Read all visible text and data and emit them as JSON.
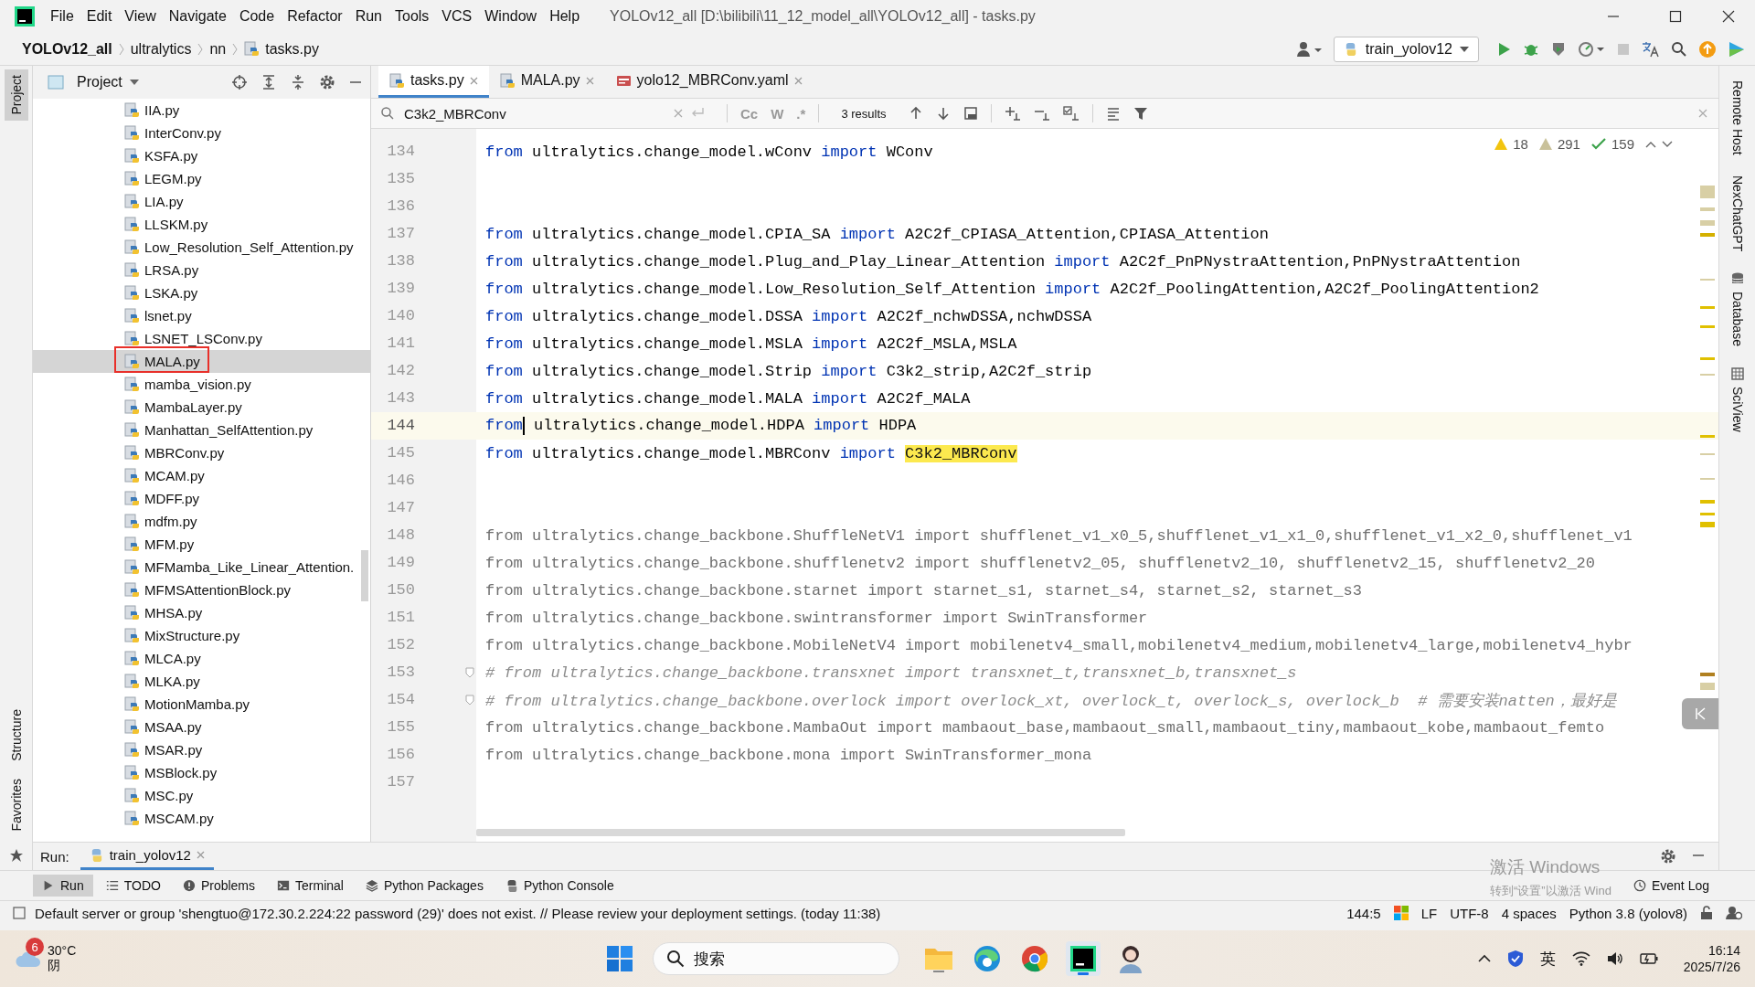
{
  "window": {
    "title": "YOLOv12_all [D:\\bilibili\\11_12_model_all\\YOLOv12_all] - tasks.py",
    "menu": [
      "File",
      "Edit",
      "View",
      "Navigate",
      "Code",
      "Refactor",
      "Run",
      "Tools",
      "VCS",
      "Window",
      "Help"
    ]
  },
  "navigation": {
    "breadcrumbs": [
      "YOLOv12_all",
      "ultralytics",
      "nn",
      "tasks.py"
    ],
    "run_config": "train_yolov12"
  },
  "left_tool_windows": [
    {
      "label": "Project",
      "selected": true
    },
    {
      "label": "Structure",
      "selected": false
    },
    {
      "label": "Favorites",
      "selected": false
    }
  ],
  "project_panel": {
    "title": "Project",
    "items": [
      {
        "name": "IIA.py",
        "selected": false,
        "outlined": false
      },
      {
        "name": "InterConv.py",
        "selected": false,
        "outlined": false
      },
      {
        "name": "KSFA.py",
        "selected": false,
        "outlined": false
      },
      {
        "name": "LEGM.py",
        "selected": false,
        "outlined": false
      },
      {
        "name": "LIA.py",
        "selected": false,
        "outlined": false
      },
      {
        "name": "LLSKM.py",
        "selected": false,
        "outlined": false
      },
      {
        "name": "Low_Resolution_Self_Attention.py",
        "selected": false,
        "outlined": false
      },
      {
        "name": "LRSA.py",
        "selected": false,
        "outlined": false
      },
      {
        "name": "LSKA.py",
        "selected": false,
        "outlined": false
      },
      {
        "name": "lsnet.py",
        "selected": false,
        "outlined": false
      },
      {
        "name": "LSNET_LSConv.py",
        "selected": false,
        "outlined": false
      },
      {
        "name": "MALA.py",
        "selected": true,
        "outlined": true
      },
      {
        "name": "mamba_vision.py",
        "selected": false,
        "outlined": false
      },
      {
        "name": "MambaLayer.py",
        "selected": false,
        "outlined": false
      },
      {
        "name": "Manhattan_SelfAttention.py",
        "selected": false,
        "outlined": false
      },
      {
        "name": "MBRConv.py",
        "selected": false,
        "outlined": false
      },
      {
        "name": "MCAM.py",
        "selected": false,
        "outlined": false
      },
      {
        "name": "MDFF.py",
        "selected": false,
        "outlined": false
      },
      {
        "name": "mdfm.py",
        "selected": false,
        "outlined": false
      },
      {
        "name": "MFM.py",
        "selected": false,
        "outlined": false
      },
      {
        "name": "MFMamba_Like_Linear_Attention.",
        "selected": false,
        "outlined": false
      },
      {
        "name": "MFMSAttentionBlock.py",
        "selected": false,
        "outlined": false
      },
      {
        "name": "MHSA.py",
        "selected": false,
        "outlined": false
      },
      {
        "name": "MixStructure.py",
        "selected": false,
        "outlined": false
      },
      {
        "name": "MLCA.py",
        "selected": false,
        "outlined": false
      },
      {
        "name": "MLKA.py",
        "selected": false,
        "outlined": false
      },
      {
        "name": "MotionMamba.py",
        "selected": false,
        "outlined": false
      },
      {
        "name": "MSAA.py",
        "selected": false,
        "outlined": false
      },
      {
        "name": "MSAR.py",
        "selected": false,
        "outlined": false
      },
      {
        "name": "MSBlock.py",
        "selected": false,
        "outlined": false
      },
      {
        "name": "MSC.py",
        "selected": false,
        "outlined": false
      },
      {
        "name": "MSCAM.py",
        "selected": false,
        "outlined": false
      }
    ]
  },
  "editor_tabs": [
    {
      "label": "tasks.py",
      "selected": true,
      "kind": "python"
    },
    {
      "label": "MALA.py",
      "selected": false,
      "kind": "python"
    },
    {
      "label": "yolo12_MBRConv.yaml",
      "selected": false,
      "kind": "yaml"
    }
  ],
  "find": {
    "value": "C3k2_MBRConv",
    "options": [
      "Cc",
      "W",
      ".*"
    ],
    "results": "3 results"
  },
  "inspections": {
    "warnings": "18",
    "weak_warnings": "291",
    "typos": "159"
  },
  "code_lines": [
    {
      "number": "134",
      "kind": "code",
      "current": false,
      "segments": [
        {
          "kind": "keyword",
          "text": "from"
        },
        {
          "kind": "name",
          "text": " ultralytics.change_model.wConv "
        },
        {
          "kind": "keyword",
          "text": "import"
        },
        {
          "kind": "name",
          "text": " WConv"
        }
      ]
    },
    {
      "number": "135",
      "kind": "blank",
      "current": false
    },
    {
      "number": "136",
      "kind": "blank",
      "current": false
    },
    {
      "number": "137",
      "kind": "code",
      "current": false,
      "segments": [
        {
          "kind": "keyword",
          "text": "from"
        },
        {
          "kind": "name",
          "text": " ultralytics.change_model.CPIA_SA "
        },
        {
          "kind": "keyword",
          "text": "import"
        },
        {
          "kind": "name",
          "text": " A2C2f_CPIASA_Attention,CPIASA_Attention"
        }
      ]
    },
    {
      "number": "138",
      "kind": "code",
      "current": false,
      "segments": [
        {
          "kind": "keyword",
          "text": "from"
        },
        {
          "kind": "name",
          "text": " ultralytics.change_model.Plug_and_Play_Linear_Attention "
        },
        {
          "kind": "keyword",
          "text": "import"
        },
        {
          "kind": "name",
          "text": " A2C2f_PnPNystraAttention,PnPNystraAttention"
        }
      ]
    },
    {
      "number": "139",
      "kind": "code",
      "current": false,
      "segments": [
        {
          "kind": "keyword",
          "text": "from"
        },
        {
          "kind": "name",
          "text": " ultralytics.change_model.Low_Resolution_Self_Attention "
        },
        {
          "kind": "keyword",
          "text": "import"
        },
        {
          "kind": "name",
          "text": " A2C2f_PoolingAttention,A2C2f_PoolingAttention2"
        }
      ]
    },
    {
      "number": "140",
      "kind": "code",
      "current": false,
      "segments": [
        {
          "kind": "keyword",
          "text": "from"
        },
        {
          "kind": "name",
          "text": " ultralytics.change_model.DSSA "
        },
        {
          "kind": "keyword",
          "text": "import"
        },
        {
          "kind": "name",
          "text": " A2C2f_nchwDSSA,nchwDSSA"
        }
      ]
    },
    {
      "number": "141",
      "kind": "code",
      "current": false,
      "segments": [
        {
          "kind": "keyword",
          "text": "from"
        },
        {
          "kind": "name",
          "text": " ultralytics.change_model.MSLA "
        },
        {
          "kind": "keyword",
          "text": "import"
        },
        {
          "kind": "name",
          "text": " A2C2f_MSLA,MSLA"
        }
      ]
    },
    {
      "number": "142",
      "kind": "code",
      "current": false,
      "segments": [
        {
          "kind": "keyword",
          "text": "from"
        },
        {
          "kind": "name",
          "text": " ultralytics.change_model.Strip "
        },
        {
          "kind": "keyword",
          "text": "import"
        },
        {
          "kind": "name",
          "text": " C3k2_strip,A2C2f_strip"
        }
      ]
    },
    {
      "number": "143",
      "kind": "code",
      "current": false,
      "segments": [
        {
          "kind": "keyword",
          "text": "from"
        },
        {
          "kind": "name",
          "text": " ultralytics.change_model.MALA "
        },
        {
          "kind": "keyword",
          "text": "import"
        },
        {
          "kind": "name",
          "text": " A2C2f_MALA"
        }
      ]
    },
    {
      "number": "144",
      "kind": "code",
      "current": true,
      "segments": [
        {
          "kind": "keyword",
          "text": "from"
        },
        {
          "kind": "name",
          "text": " ultralytics.change_model.HDPA "
        },
        {
          "kind": "keyword",
          "text": "import"
        },
        {
          "kind": "name",
          "text": " HDPA"
        }
      ]
    },
    {
      "number": "145",
      "kind": "code",
      "current": false,
      "segments": [
        {
          "kind": "keyword",
          "text": "from"
        },
        {
          "kind": "name",
          "text": " ultralytics.change_model.MBRConv "
        },
        {
          "kind": "keyword",
          "text": "import "
        },
        {
          "kind": "match",
          "text": "C3k2_MBRConv"
        }
      ]
    },
    {
      "number": "146",
      "kind": "blank",
      "current": false
    },
    {
      "number": "147",
      "kind": "blank",
      "current": false
    },
    {
      "number": "148",
      "kind": "unused",
      "current": false,
      "text": "from ultralytics.change_backbone.ShuffleNetV1 import shufflenet_v1_x0_5,shufflenet_v1_x1_0,shufflenet_v1_x2_0,shufflenet_v1"
    },
    {
      "number": "149",
      "kind": "unused",
      "current": false,
      "text": "from ultralytics.change_backbone.shufflenetv2 import shufflenetv2_05, shufflenetv2_10, shufflenetv2_15, shufflenetv2_20"
    },
    {
      "number": "150",
      "kind": "unused",
      "current": false,
      "text": "from ultralytics.change_backbone.starnet import starnet_s1, starnet_s4, starnet_s2, starnet_s3"
    },
    {
      "number": "151",
      "kind": "unused",
      "current": false,
      "text": "from ultralytics.change_backbone.swintransformer import SwinTransformer"
    },
    {
      "number": "152",
      "kind": "unused",
      "current": false,
      "text": "from ultralytics.change_backbone.MobileNetV4 import mobilenetv4_small,mobilenetv4_medium,mobilenetv4_large,mobilenetv4_hybr"
    },
    {
      "number": "153",
      "kind": "comment",
      "current": false,
      "text": "# from ultralytics.change_backbone.transxnet import transxnet_t,transxnet_b,transxnet_s"
    },
    {
      "number": "154",
      "kind": "comment",
      "current": false,
      "text": "# from ultralytics.change_backbone.overlock import overlock_xt, overlock_t, overlock_s, overlock_b  # 需要安装natten，最好是"
    },
    {
      "number": "155",
      "kind": "unused",
      "current": false,
      "text": "from ultralytics.change_backbone.MambaOut import mambaout_base,mambaout_small,mambaout_tiny,mambaout_kobe,mambaout_femto"
    },
    {
      "number": "156",
      "kind": "unused",
      "current": false,
      "text": "from ultralytics.change_backbone.mona import SwinTransformer_mona"
    },
    {
      "number": "157",
      "kind": "blank",
      "current": false
    }
  ],
  "right_tool_windows": [
    "Remote Host",
    "NexChatGPT",
    "Database",
    "SciView"
  ],
  "run_panel": {
    "label": "Run:",
    "tab": "train_yolov12"
  },
  "bottom_tabs": [
    {
      "label": "Run",
      "selected": true
    },
    {
      "label": "TODO",
      "selected": false
    },
    {
      "label": "Problems",
      "selected": false
    },
    {
      "label": "Terminal",
      "selected": false
    },
    {
      "label": "Python Packages",
      "selected": false
    },
    {
      "label": "Python Console",
      "selected": false
    }
  ],
  "event_log": "Event Log",
  "activation_notice": {
    "title": "激活 Windows",
    "text": "转到“设置”以激活 Wind"
  },
  "status_bar": {
    "message": "Default server or group 'shengtuo@172.30.2.224:22 password (29)' does not exist. // Please review your deployment settings. (today 11:38)",
    "position": "144:5",
    "items": [
      "LF",
      "UTF-8",
      "4 spaces",
      "Python 3.8 (yolov8)"
    ]
  },
  "taskbar": {
    "weather": {
      "badge": "6",
      "temperature": "30°C",
      "condition": "阴"
    },
    "search": "搜索",
    "language": "英",
    "time": "16:14",
    "date": "2025/7/26"
  }
}
